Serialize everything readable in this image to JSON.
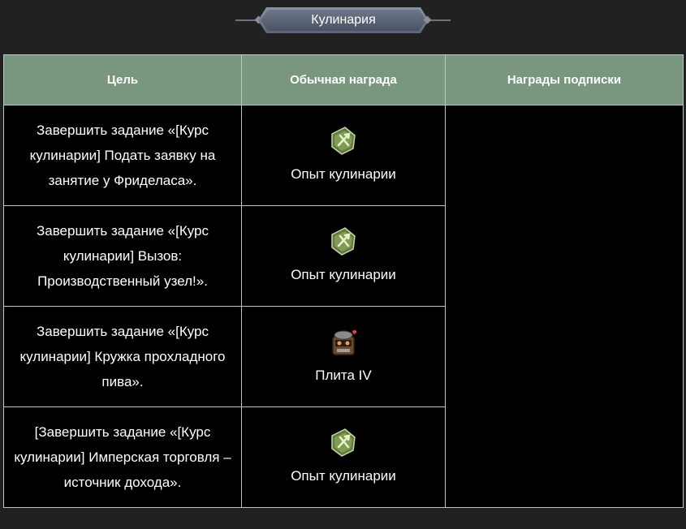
{
  "header": {
    "title": "Кулинария"
  },
  "table": {
    "columns": [
      "Цель",
      "Обычная награда",
      "Награды подписки"
    ],
    "rows": [
      {
        "goal": "Завершить задание «[Курс кулинарии] Подать заявку на занятие у Фриделаса».",
        "reward": "Опыт кулинарии",
        "reward_icon": "cooking-xp-icon"
      },
      {
        "goal": "Завершить задание «[Курс кулинарии] Вызов: Производственный узел!».",
        "reward": "Опыт кулинарии",
        "reward_icon": "cooking-xp-icon"
      },
      {
        "goal": "Завершить задание «[Курс кулинарии] Кружка прохладного пива».",
        "reward": "Плита IV",
        "reward_icon": "cooking-stove-icon"
      },
      {
        "goal": "[Завершить задание «[Курс кулинарии] Имперская торговля – источник дохода».",
        "reward": "Опыт кулинарии",
        "reward_icon": "cooking-xp-icon"
      }
    ]
  },
  "colors": {
    "page_bg": "#212121",
    "header_bg": "#79967f",
    "cell_bg": "#000000",
    "border": "#b9c9bd"
  }
}
